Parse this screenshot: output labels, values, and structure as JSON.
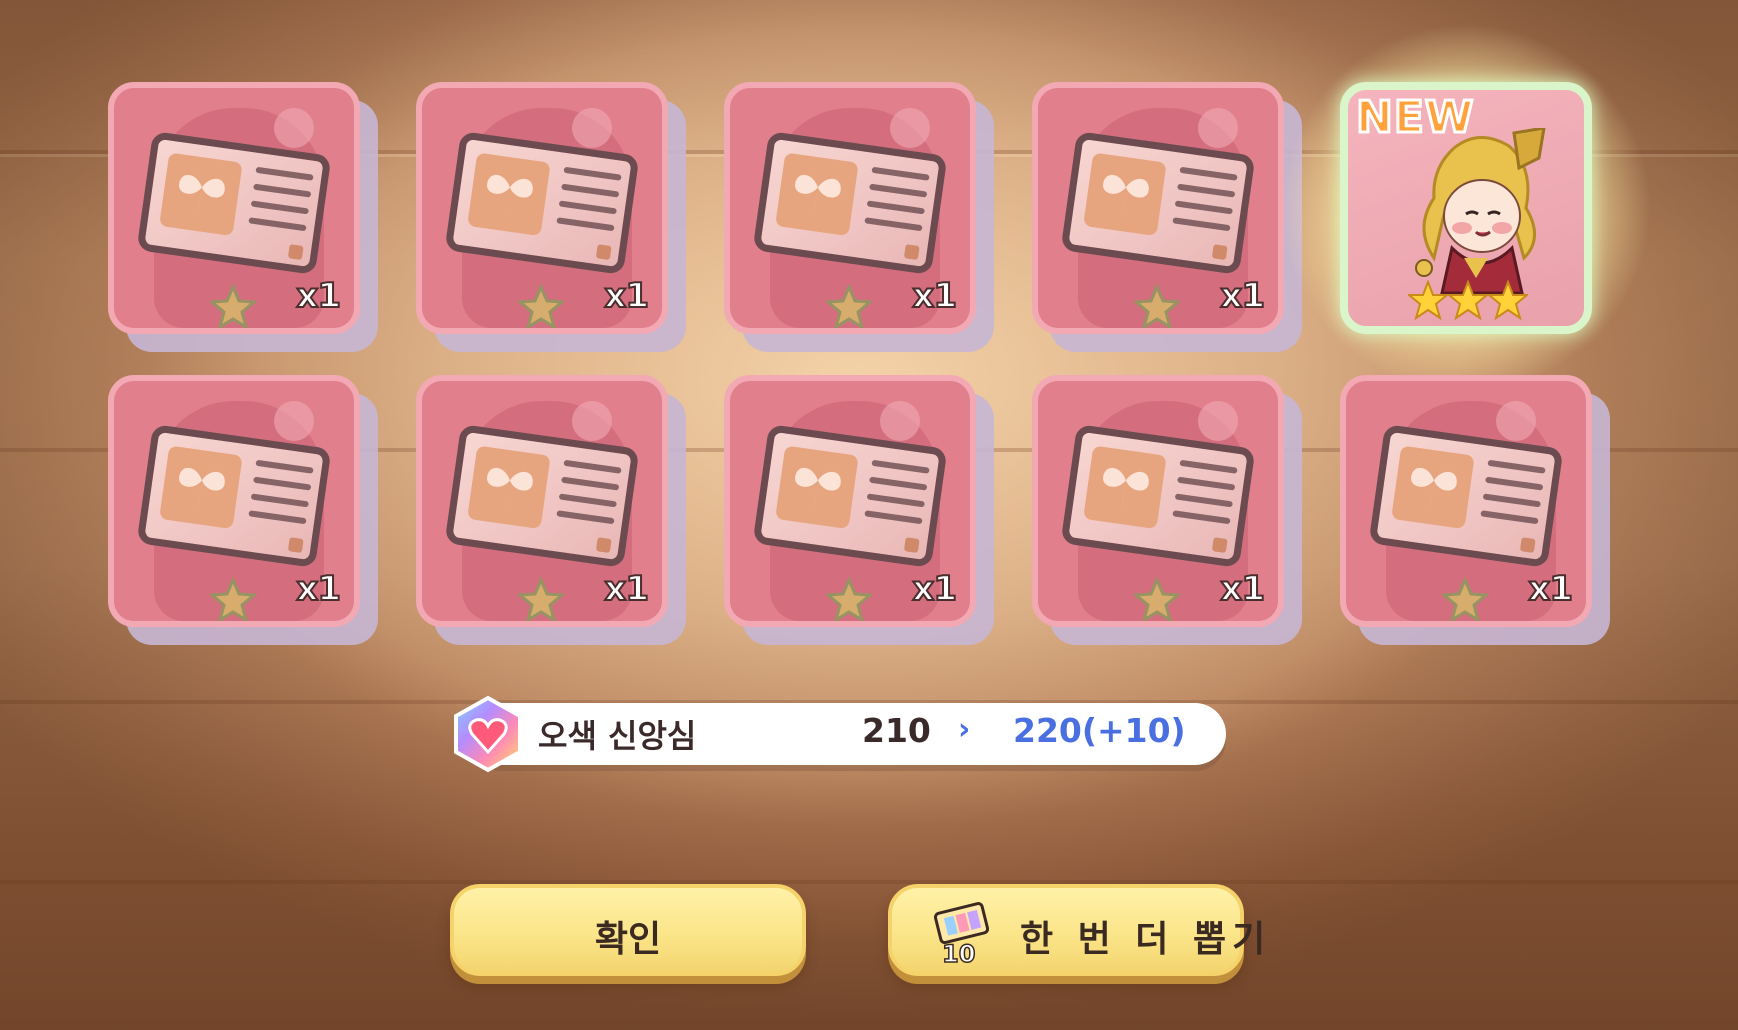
{
  "cards_row1": [
    {
      "count": "x1",
      "kind": "id-card-item"
    },
    {
      "count": "x1",
      "kind": "id-card-item"
    },
    {
      "count": "x1",
      "kind": "id-card-item"
    },
    {
      "count": "x1",
      "kind": "id-card-item"
    }
  ],
  "featured_card": {
    "badge": "NEW",
    "stars": 3,
    "kind": "character-portrait"
  },
  "cards_row2": [
    {
      "count": "x1",
      "kind": "id-card-item"
    },
    {
      "count": "x1",
      "kind": "id-card-item"
    },
    {
      "count": "x1",
      "kind": "id-card-item"
    },
    {
      "count": "x1",
      "kind": "id-card-item"
    },
    {
      "count": "x1",
      "kind": "id-card-item"
    }
  ],
  "stat": {
    "icon": "rainbow-heart-gem-icon",
    "name": "오색 신앙심",
    "old_value": "210",
    "arrow": "›",
    "new_value": "220(+10)"
  },
  "buttons": {
    "confirm_label": "확인",
    "draw_again_label": "한 번 더 뽑기",
    "ticket_count": "10"
  },
  "colors": {
    "card_pink": "#e17f8d",
    "card_border": "#f3a9b4",
    "button_yellow": "#fbe58a",
    "new_orange": "#ffa23c",
    "stat_blue": "#4a6fe0"
  }
}
